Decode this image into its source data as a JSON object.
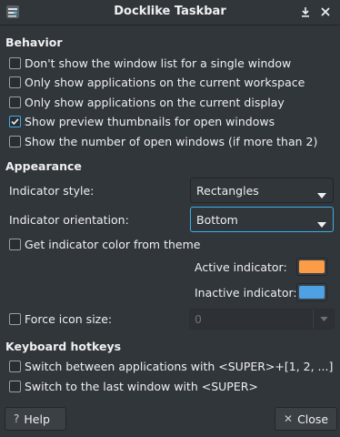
{
  "window": {
    "title": "Docklike Taskbar",
    "icons": {
      "app": "settings-icon",
      "pin": "pin-icon",
      "close": "close-icon"
    }
  },
  "behavior": {
    "title": "Behavior",
    "options": [
      {
        "label": "Don't show the window list for a single window",
        "checked": false
      },
      {
        "label": "Only show applications on the current workspace",
        "checked": false
      },
      {
        "label": "Only show applications on the current display",
        "checked": false
      },
      {
        "label": "Show preview thumbnails for open windows",
        "checked": true
      },
      {
        "label": "Show the number of open windows (if more than 2)",
        "checked": false
      }
    ]
  },
  "appearance": {
    "title": "Appearance",
    "indicator_style_label": "Indicator style:",
    "indicator_style_value": "Rectangles",
    "indicator_orientation_label": "Indicator orientation:",
    "indicator_orientation_value": "Bottom",
    "theme_color_label": "Get indicator color from theme",
    "theme_color_checked": false,
    "active_indicator_label": "Active indicator:",
    "active_indicator_color": "#fd9c47",
    "inactive_indicator_label": "Inactive indicator:",
    "inactive_indicator_color": "#4ea2e4",
    "force_icon_size_label": "Force icon size:",
    "force_icon_size_checked": false,
    "force_icon_size_value": "0"
  },
  "hotkeys": {
    "title": "Keyboard hotkeys",
    "options": [
      {
        "label": "Switch between applications with <SUPER>+[1, 2, ...]",
        "checked": false
      },
      {
        "label": "Switch to the last window with <SUPER>",
        "checked": false
      }
    ]
  },
  "buttons": {
    "help_label": "Help",
    "help_glyph": "?",
    "close_label": "Close",
    "close_glyph": "✕"
  },
  "colors": {
    "background": "#31363b",
    "accent": "#3daee9",
    "text": "#eff0f1"
  }
}
